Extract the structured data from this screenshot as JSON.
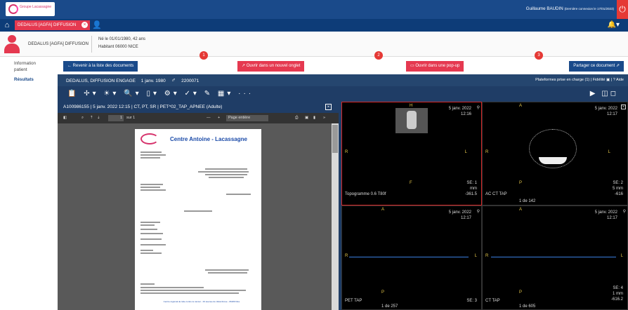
{
  "header": {
    "logo_text": "Groupe Lacassagne",
    "user_label": "Guillaume BAUDIN",
    "last_connection": "(Dernière connexion le 17/01/2023)"
  },
  "tabs": [
    {
      "label": "DEDALUS [AGFA] DIFFUSION"
    }
  ],
  "patient": {
    "name": "DEDALUS [AGFA] DIFFUSION",
    "birth": "Né le 01/01/1980, 42 ans",
    "address": "Habitant 06000 NICE"
  },
  "sidebar": {
    "items": [
      {
        "label": "Information"
      },
      {
        "label": "patient"
      },
      {
        "label": "Résultats"
      }
    ]
  },
  "actions": {
    "back_label": "Revenir à la liste des documents",
    "new_tab_label": "Ouvrir dans un nouvel onglet",
    "popup_label": "Ouvrir dans une pop-up",
    "share_label": "Partager ce document",
    "markers": [
      "1",
      "2",
      "3"
    ]
  },
  "viewer": {
    "title": "DEDALUS, DIFFUSION ENGAGE",
    "birth": "1 janv. 1980",
    "id": "2200071",
    "right_info": "Plateformes prise en charge",
    "right_count": "1",
    "fidelity": "Fidélité",
    "help": "Aide",
    "study_info": "A100986155 | 5 janv. 2022 12:15 | CT, PT, SR | PET^02_TAP_APNEE (Adulte)",
    "pdf_page": "1",
    "pdf_total": "sur 1",
    "pdf_zoom": "Page entière"
  },
  "document": {
    "title": "Centre Antoine - Lacassagne",
    "footer": "Centre régional de lutte contre le cancer - 33 avenue de Valombrose - 06189 Nice"
  },
  "viewports": [
    {
      "date": "5 janv. 2022",
      "time": "12:16",
      "top": "H",
      "left": "R",
      "right": "L",
      "bottom": "F",
      "series": "SE: 1",
      "unit": "mm",
      "value": "-361.5",
      "label": "Topogramme 0.6 T80f"
    },
    {
      "date": "5 janv. 2022",
      "time": "12:17",
      "top": "A",
      "left": "R",
      "right": "L",
      "bottom": "P",
      "series": "SE: 2",
      "unit": "5 mm",
      "value": "-616",
      "label": "AC CT TAP",
      "count": "1 de 142"
    },
    {
      "date": "5 janv. 2022",
      "time": "12:17",
      "top": "A",
      "left": "R",
      "right": "L",
      "bottom": "P",
      "series": "SE: 3",
      "label": "PET TAP",
      "count": "1 de 257"
    },
    {
      "date": "5 janv. 2022",
      "time": "12:17",
      "top": "A",
      "left": "R",
      "right": "L",
      "bottom": "P",
      "series": "SE: 4",
      "unit": "1 mm",
      "value": "-616.2",
      "label": "CT TAP",
      "count": "1 de 605"
    }
  ]
}
